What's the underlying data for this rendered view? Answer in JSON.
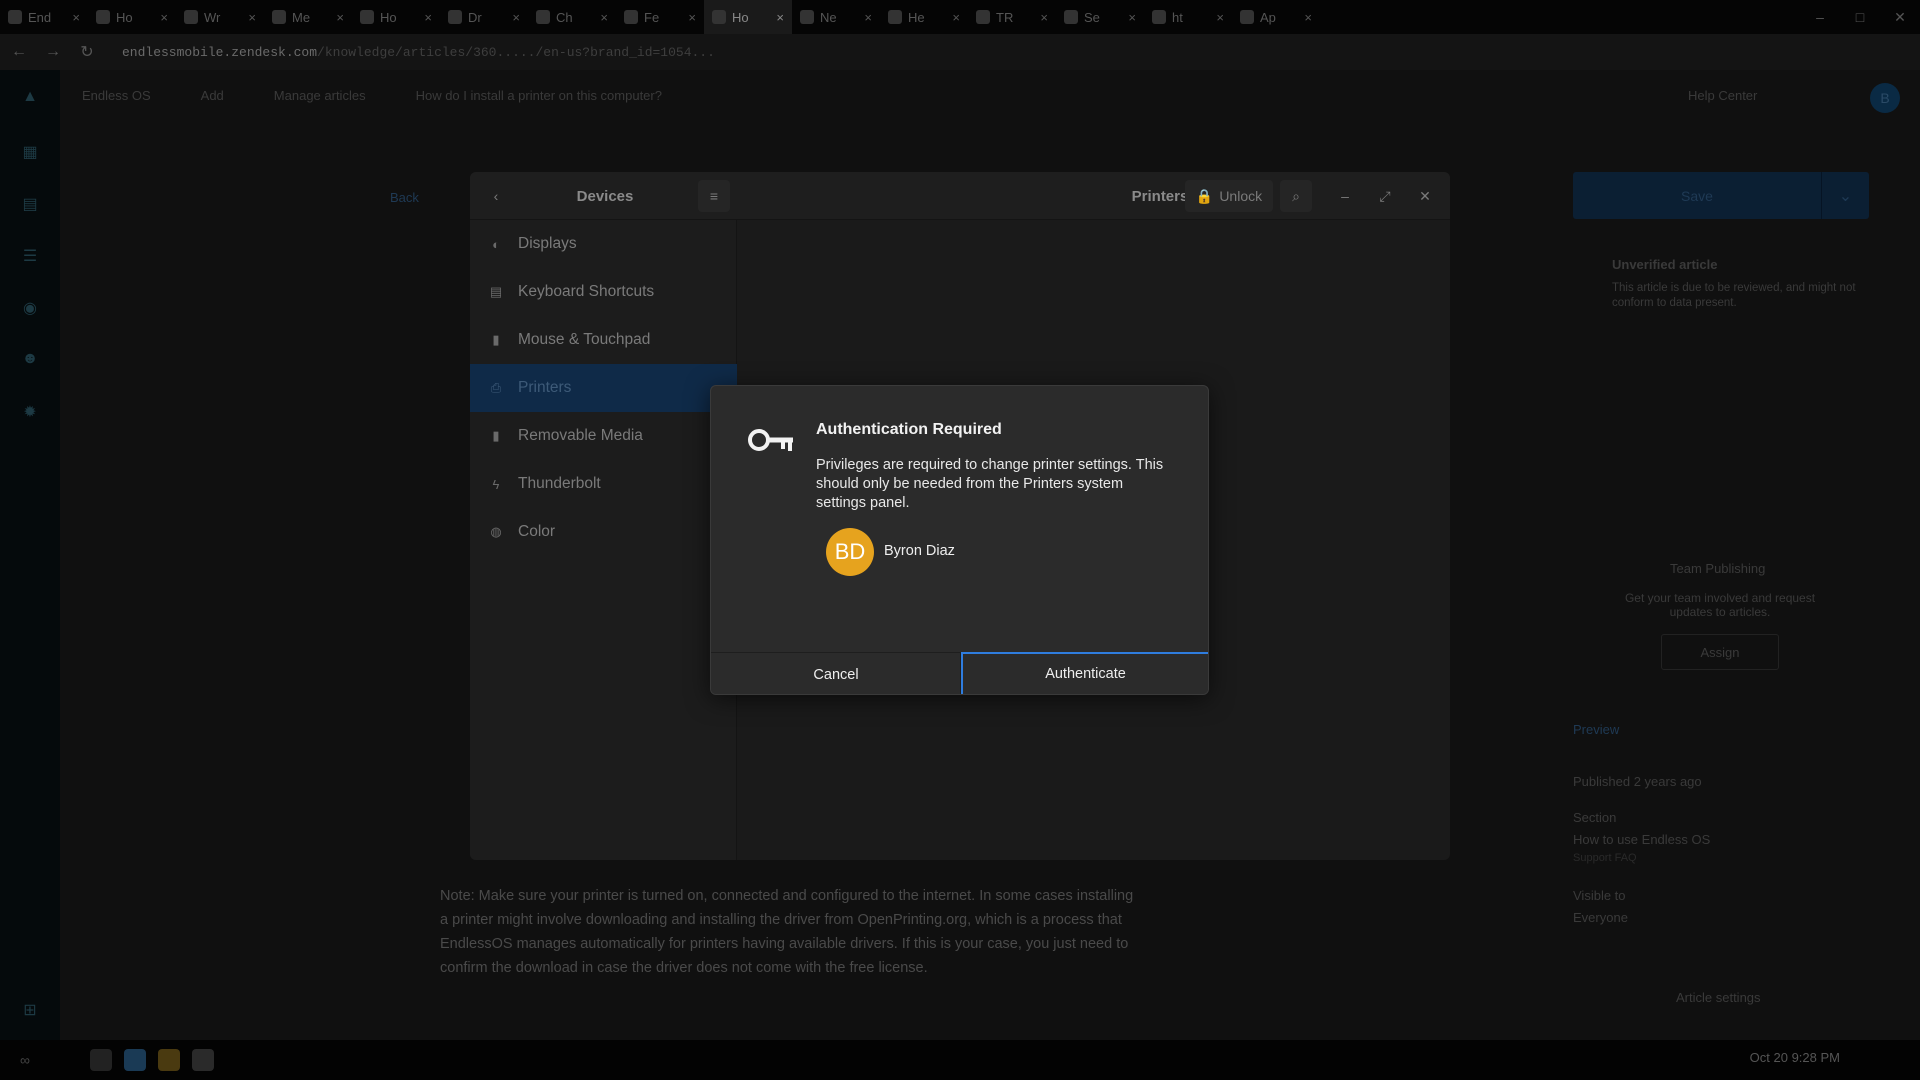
{
  "browser": {
    "tabs": [
      {
        "label": "End"
      },
      {
        "label": "Ho"
      },
      {
        "label": "Wr"
      },
      {
        "label": "Me"
      },
      {
        "label": "Ho"
      },
      {
        "label": "Dr"
      },
      {
        "label": "Ch"
      },
      {
        "label": "Fe"
      },
      {
        "label": "Ho"
      },
      {
        "label": "Ne"
      },
      {
        "label": "He"
      },
      {
        "label": "TR"
      },
      {
        "label": "Se"
      },
      {
        "label": "ht"
      },
      {
        "label": "Ap"
      }
    ],
    "active_tab_index": 8,
    "url_host": "endlessmobile.zendesk.com",
    "url_path": "/knowledge/articles/360...../en-us?brand_id=1054..."
  },
  "page": {
    "breadcrumbs": [
      "Endless OS",
      "Add",
      "Manage articles",
      "How do I install a printer on this computer?"
    ],
    "help_center": "Help Center",
    "avatar_initial": "B",
    "back": "Back",
    "article_note": "Note: Make sure your printer is turned on, connected and configured to the internet. In some cases installing a printer might involve downloading and installing the driver from OpenPrinting.org, which is a process that EndlessOS manages automatically for printers having available drivers. If this is your case, you just need to confirm the download in case the driver does not come with the free license.",
    "save_label": "Save",
    "unverified_title": "Unverified article",
    "unverified_desc": "This article is due to be reviewed, and might not conform to data present.",
    "team_title": "Team Publishing",
    "team_desc": "Get your team involved and request updates to articles.",
    "assign_label": "Assign",
    "preview_label": "Preview",
    "published_label": "Published 2 years ago",
    "section_label": "Section",
    "section_value": "How to use Endless OS",
    "section_sub": "Support FAQ",
    "visible_label": "Visible to",
    "visible_value": "Everyone",
    "article_settings": "Article settings",
    "clock": "Oct 20  9:28 PM"
  },
  "settings": {
    "panel_title": "Devices",
    "page_title": "Printers",
    "unlock_label": "Unlock",
    "sidebar": [
      {
        "label": "Displays",
        "icon": "display-icon"
      },
      {
        "label": "Keyboard Shortcuts",
        "icon": "keyboard-icon"
      },
      {
        "label": "Mouse & Touchpad",
        "icon": "mouse-icon"
      },
      {
        "label": "Printers",
        "icon": "printer-icon"
      },
      {
        "label": "Removable Media",
        "icon": "usb-icon"
      },
      {
        "label": "Thunderbolt",
        "icon": "thunderbolt-icon"
      },
      {
        "label": "Color",
        "icon": "color-icon"
      }
    ],
    "selected_index": 3
  },
  "dialog": {
    "title": "Authentication Required",
    "message": "Privileges are required to change printer settings. This should only be needed from the Printers system settings panel.",
    "user_initials": "BD",
    "user_name": "Byron Diaz",
    "cancel_label": "Cancel",
    "authenticate_label": "Authenticate",
    "accent": "#2f7ddf",
    "avatar_color": "#e6a31e"
  }
}
